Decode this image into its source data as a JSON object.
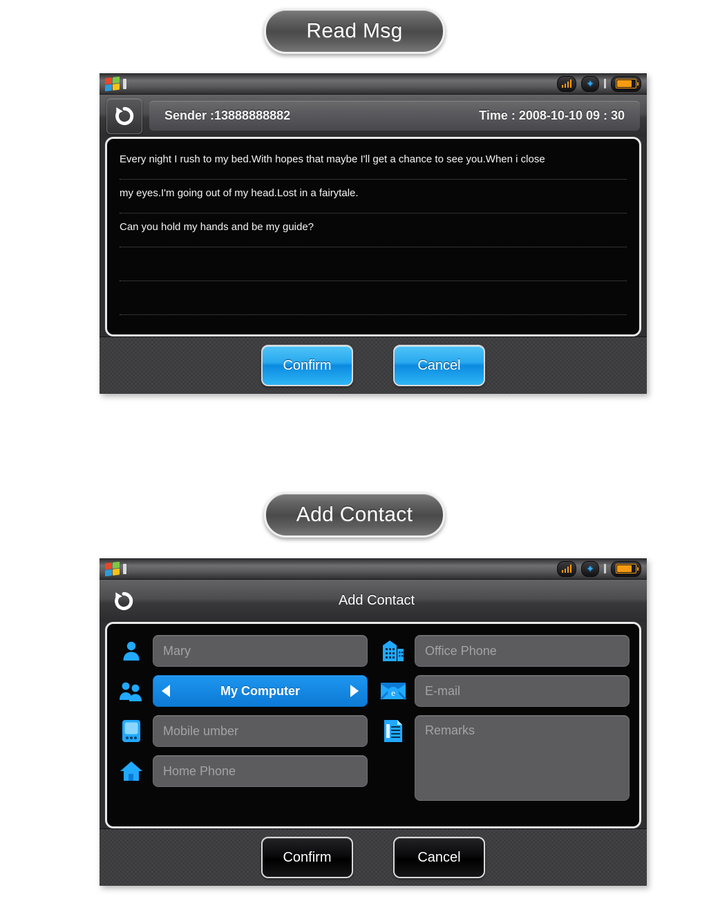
{
  "sections": [
    {
      "pill_label": "Read Msg",
      "statusbar": {
        "logo": "windows-logo-icon",
        "signal": "signal-bars-icon",
        "bluetooth": "bluetooth-icon",
        "battery": "battery-icon"
      },
      "header": {
        "back": "back-arrow-icon",
        "sender_label": "Sender :13888888882",
        "time_label": "Time :  2008-10-10   09 : 30"
      },
      "message_lines": [
        "Every night I rush to my bed.With hopes that maybe I'll get a chance to see you.When i close",
        "my eyes.I'm going out of my head.Lost in a fairytale.",
        "Can you hold my hands and be my guide?",
        "",
        "",
        ""
      ],
      "buttons": {
        "confirm": "Confirm",
        "cancel": "Cancel",
        "style": "blue"
      }
    },
    {
      "pill_label": "Add Contact",
      "statusbar": {
        "logo": "windows-logo-icon",
        "signal": "signal-bars-icon",
        "bluetooth": "bluetooth-icon",
        "battery": "battery-icon"
      },
      "header": {
        "back": "back-arrow-icon",
        "title": "Add Contact"
      },
      "form": {
        "left": [
          {
            "icon": "person-icon",
            "type": "text",
            "value": "Mary"
          },
          {
            "icon": "group-icon",
            "type": "select",
            "value": "My Computer"
          },
          {
            "icon": "mobile-icon",
            "type": "text",
            "value": "Mobile umber"
          },
          {
            "icon": "home-icon",
            "type": "text",
            "value": "Home Phone"
          }
        ],
        "right": [
          {
            "icon": "building-icon",
            "type": "text",
            "value": "Office Phone"
          },
          {
            "icon": "email-icon",
            "type": "text",
            "value": "E-mail"
          },
          {
            "icon": "notes-icon",
            "type": "textarea",
            "value": "Remarks"
          }
        ]
      },
      "buttons": {
        "confirm": "Confirm",
        "cancel": "Cancel",
        "style": "dark"
      }
    }
  ],
  "colors": {
    "accent_blue": "#0d7ad6",
    "button_blue": "#29a9ef",
    "icon_blue": "#1fa5ff",
    "status_orange": "#f59a12",
    "panel_dark": "#060606"
  }
}
